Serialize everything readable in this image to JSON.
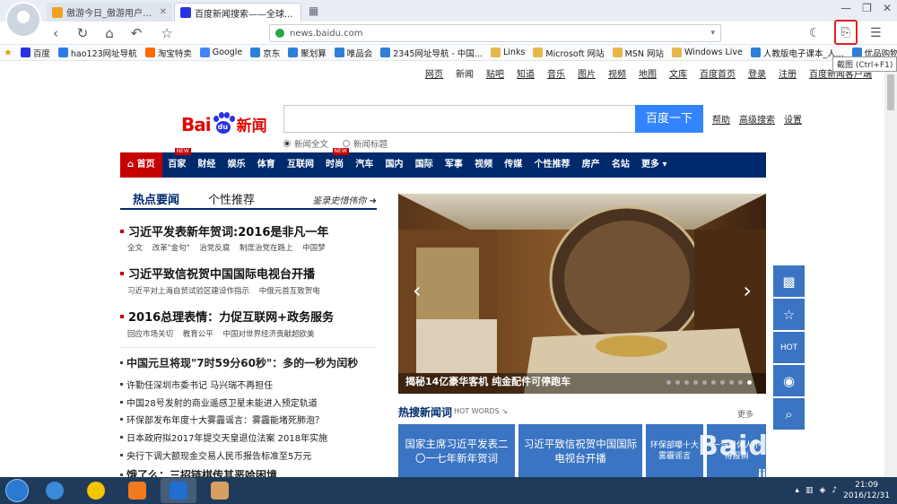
{
  "browser": {
    "tabs": [
      {
        "label": "傲游今日_傲游用户专属...",
        "active": false
      },
      {
        "label": "百度新闻搜索——全球...",
        "active": true
      }
    ],
    "address": "news.baidu.com",
    "screenshot_tooltip": "截图 (Ctrl+F1)",
    "bookmarks": [
      "百度",
      "hao123网址导航",
      "淘宝特卖",
      "Google",
      "京东",
      "聚划算",
      "唯品会",
      "2345网址导航 - 中国...",
      "Links",
      "Microsoft 网站",
      "MSN 网站",
      "Windows Live",
      "人教版电子课本_人...",
      "优品购物"
    ]
  },
  "page": {
    "top_links": [
      "网页",
      "新闻",
      "贴吧",
      "知道",
      "音乐",
      "图片",
      "视频",
      "地图",
      "文库",
      "百度首页",
      "登录",
      "注册",
      "百度新闻客户端"
    ],
    "logo": {
      "bai": "Bai",
      "du": "du",
      "news": "新闻"
    },
    "search_button": "百度一下",
    "search_links": [
      "帮助",
      "高级搜索",
      "设置"
    ],
    "radio_options": [
      "新闻全文",
      "新闻标题"
    ],
    "categories": [
      {
        "label": "首页",
        "badge": ""
      },
      {
        "label": "百家",
        "badge": "NEW"
      },
      {
        "label": "财经",
        "badge": ""
      },
      {
        "label": "娱乐",
        "badge": ""
      },
      {
        "label": "体育",
        "badge": ""
      },
      {
        "label": "互联网",
        "badge": ""
      },
      {
        "label": "时尚",
        "badge": "NEW"
      },
      {
        "label": "汽车",
        "badge": ""
      },
      {
        "label": "国内",
        "badge": ""
      },
      {
        "label": "国际",
        "badge": ""
      },
      {
        "label": "军事",
        "badge": ""
      },
      {
        "label": "视频",
        "badge": ""
      },
      {
        "label": "传媒",
        "badge": ""
      },
      {
        "label": "个性推荐",
        "badge": ""
      },
      {
        "label": "房产",
        "badge": ""
      },
      {
        "label": "名站",
        "badge": ""
      },
      {
        "label": "更多",
        "badge": ""
      }
    ],
    "section_tabs": {
      "hot": "热点要闻",
      "personal": "个性推荐",
      "tagline": "鉴录史惜伟你"
    },
    "headlines": [
      {
        "title": "习近平发表新年贺词:2016是非凡一年",
        "subs": [
          "全文",
          "改革\"金句\"",
          "治党反腐",
          "制度治党在路上",
          "中国梦"
        ]
      },
      {
        "title": "习近平致信祝贺中国国际电视台开播",
        "subs": [
          "习近平对上海自贸试验区建设作指示",
          "中俄元首互致贺电"
        ]
      },
      {
        "title": "2016总理表情：力促互联网+政务服务",
        "subs": [
          "回应市场关切",
          "教育公平",
          "中国对世界经济贡献超欧美"
        ]
      }
    ],
    "news_lines": [
      {
        "text": "中国元旦将现\"7时59分60秒\"：多的一秒为闰秒",
        "bold": true
      },
      {
        "text": "许勤任深圳市委书记 马兴瑞不再担任",
        "bold": false
      },
      {
        "text": "中国28号发射的商业遥感卫星未能进入预定轨道",
        "bold": false
      },
      {
        "text": "环保部发布年度十大雾霾谣言：雾霾能堵死肺泡？",
        "bold": false
      },
      {
        "text": "日本政府拟2017年提交天皇退位法案 2018年实施",
        "bold": false
      },
      {
        "text": "央行下调大额现金交易人民币报告标准至5万元",
        "bold": false
      },
      {
        "text": "饿了么：三招链棋传其恶哈困境",
        "bold": true
      }
    ],
    "carousel": {
      "caption": "揭秘14亿豪华客机 纯金配件可停跑车",
      "dots": 10,
      "active_dot": 9
    },
    "hot_words": {
      "title": "热搜新闻词",
      "sub": "HOT WORDS ↘",
      "more": "更多"
    },
    "hot_cards": [
      "国家主席习近平发表二〇一七年新年贺词",
      "习近平致信祝贺中国国际电视台开播",
      "环保部曝十大雾霾谣言",
      "一汽退休人不得报销"
    ],
    "side_buttons": [
      "qr-code",
      "star",
      "HOT",
      "eye",
      "search"
    ],
    "watermark": {
      "main": "Baidu经验",
      "sub": "jingyan.baidu.com"
    }
  },
  "taskbar": {
    "clock_time": "21:09",
    "clock_date": "2016/12/31"
  }
}
